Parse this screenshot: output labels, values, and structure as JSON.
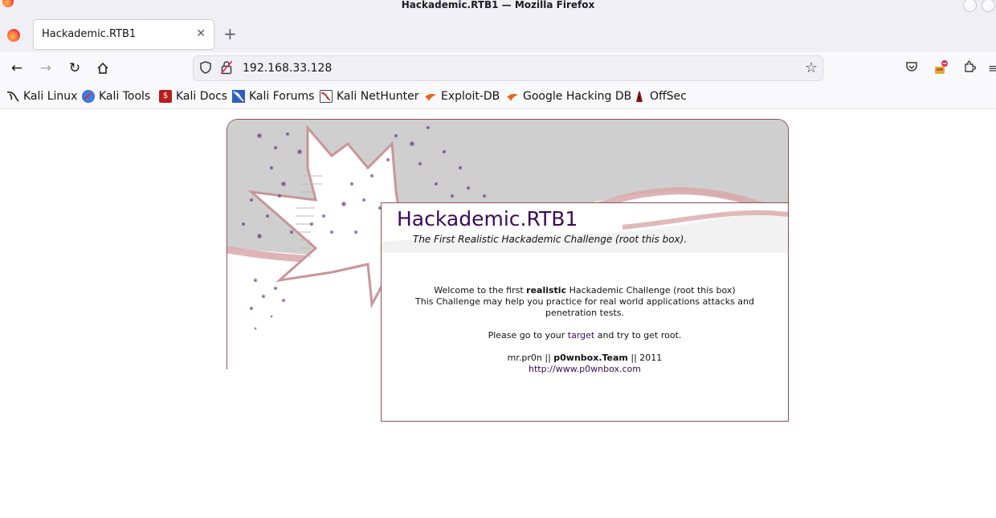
{
  "window": {
    "title": "Hackademic.RTB1 — Mozilla Firefox"
  },
  "tabs": [
    {
      "label": "Hackademic.RTB1"
    }
  ],
  "navbar": {
    "url": "192.168.33.128"
  },
  "bookmarks": [
    {
      "label": "Kali Linux",
      "icon": "kali-dragon-icon"
    },
    {
      "label": "Kali Tools",
      "icon": "kali-tools-icon"
    },
    {
      "label": "Kali Docs",
      "icon": "kali-docs-icon"
    },
    {
      "label": "Kali Forums",
      "icon": "kali-forums-icon"
    },
    {
      "label": "Kali NetHunter",
      "icon": "kali-nethunter-icon"
    },
    {
      "label": "Exploit-DB",
      "icon": "exploit-db-icon"
    },
    {
      "label": "Google Hacking DB",
      "icon": "ghdb-icon"
    },
    {
      "label": "OffSec",
      "icon": "offsec-icon"
    }
  ],
  "page": {
    "title": "Hackademic.RTB1",
    "subtitle": "The First Realistic Hackademic Challenge (root this box).",
    "welcome_prefix": "Welcome to the first ",
    "welcome_bold": "realistic",
    "welcome_suffix": " Hackademic Challenge (root this box)",
    "challenge_line": "This Challenge may help you practice for real world applications attacks and penetration tests.",
    "goto_prefix": "Please go to your ",
    "goto_link": "target",
    "goto_suffix": " and try to get root.",
    "credit_author": "mr.pr0n || ",
    "credit_team": "p0wnbox.Team",
    "credit_year": " || 2011",
    "credit_link": "http://www.p0wnbox.com"
  },
  "colors": {
    "title_purple": "#3c0a57",
    "frame_border": "#8b4f57",
    "header_grey": "#cfcfcf"
  }
}
